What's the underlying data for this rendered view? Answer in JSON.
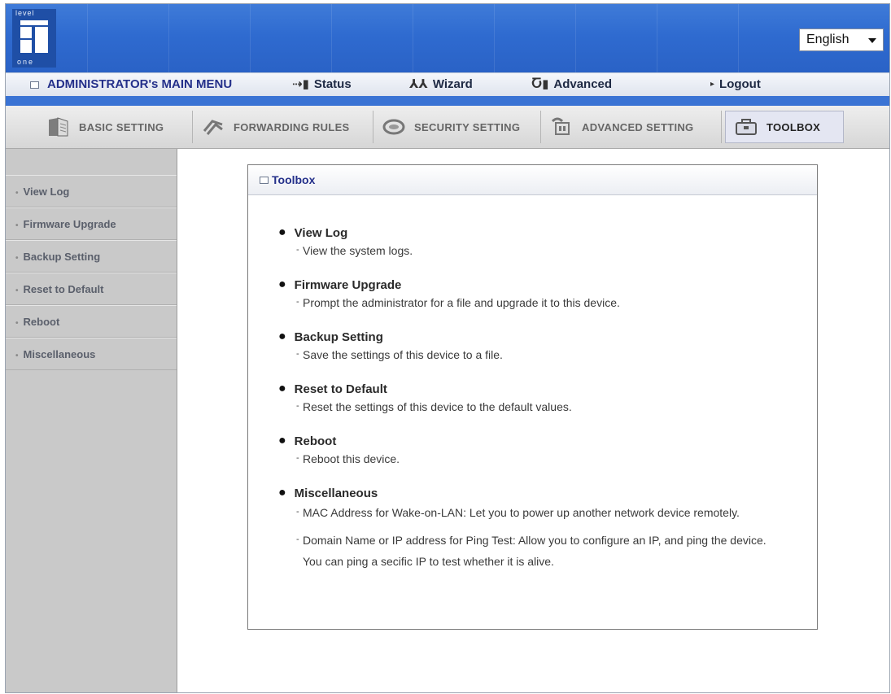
{
  "banner": {
    "logo_top": "level",
    "logo_bottom": "one",
    "language": "English"
  },
  "main_menu": {
    "admin": "ADMINISTRATOR's MAIN MENU",
    "status": "Status",
    "wizard": "Wizard",
    "advanced": "Advanced",
    "logout": "Logout"
  },
  "tabs": [
    {
      "label": "BASIC SETTING",
      "icon": "book-icon"
    },
    {
      "label": "FORWARDING RULES",
      "icon": "forward-arrows-icon"
    },
    {
      "label": "SECURITY SETTING",
      "icon": "shield-icon"
    },
    {
      "label": "ADVANCED SETTING",
      "icon": "gear-box-icon"
    },
    {
      "label": "TOOLBOX",
      "icon": "toolbox-icon"
    }
  ],
  "sidebar": {
    "items": [
      {
        "label": "View Log"
      },
      {
        "label": "Firmware Upgrade"
      },
      {
        "label": "Backup Setting"
      },
      {
        "label": "Reset to Default"
      },
      {
        "label": "Reboot"
      },
      {
        "label": "Miscellaneous"
      }
    ]
  },
  "panel": {
    "title": "Toolbox",
    "entries": [
      {
        "title": "View Log",
        "desc": [
          "View the system logs."
        ]
      },
      {
        "title": "Firmware Upgrade",
        "desc": [
          "Prompt the administrator for a file and upgrade it to this device."
        ]
      },
      {
        "title": "Backup Setting",
        "desc": [
          "Save the settings of this device to a file."
        ]
      },
      {
        "title": "Reset to Default",
        "desc": [
          "Reset the settings of this device to the default values."
        ]
      },
      {
        "title": "Reboot",
        "desc": [
          "Reboot this device."
        ]
      },
      {
        "title": "Miscellaneous",
        "desc": [
          "MAC Address for Wake-on-LAN: Let you to power up another network device remotely.",
          "Domain Name or IP address for Ping Test: Allow you to configure an IP, and ping the device. You can ping a secific IP to test whether it is alive."
        ]
      }
    ]
  }
}
